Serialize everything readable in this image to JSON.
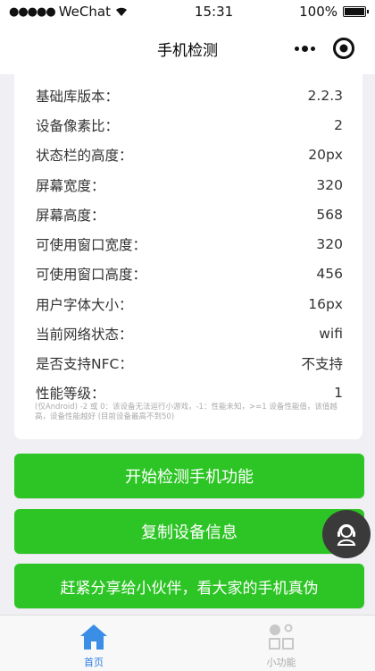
{
  "status_bar": {
    "carrier": "WeChat",
    "time": "15:31",
    "battery": "100%",
    "battery_level": 1.0
  },
  "nav": {
    "title": "手机检测"
  },
  "info": {
    "rows": [
      {
        "label": "基础库版本：",
        "value": "2.2.3"
      },
      {
        "label": "设备像素比：",
        "value": "2"
      },
      {
        "label": "状态栏的高度：",
        "value": "20px"
      },
      {
        "label": "屏幕宽度：",
        "value": "320"
      },
      {
        "label": "屏幕高度：",
        "value": "568"
      },
      {
        "label": "可使用窗口宽度：",
        "value": "320"
      },
      {
        "label": "可使用窗口高度：",
        "value": "456"
      },
      {
        "label": "用户字体大小：",
        "value": "16px"
      },
      {
        "label": "当前网络状态：",
        "value": "wifi"
      },
      {
        "label": "是否支持NFC：",
        "value": "不支持"
      },
      {
        "label": "性能等级：",
        "value": "1"
      }
    ],
    "perf_note": "(仅Android) -2 或 0：该设备无法运行小游戏，-1：性能未知，>=1 设备性能值，该值越高，设备性能越好 (目前设备最高不到50)"
  },
  "buttons": {
    "start_test": "开始检测手机功能",
    "copy_info": "复制设备信息",
    "share": "赶紧分享给小伙伴，看大家的手机真伪"
  },
  "tabs": {
    "home": "首页",
    "tools": "小功能"
  },
  "colors": {
    "button_green": "#2dc525",
    "tab_active": "#2f7ee0",
    "tab_inactive": "#aaaaaa"
  }
}
